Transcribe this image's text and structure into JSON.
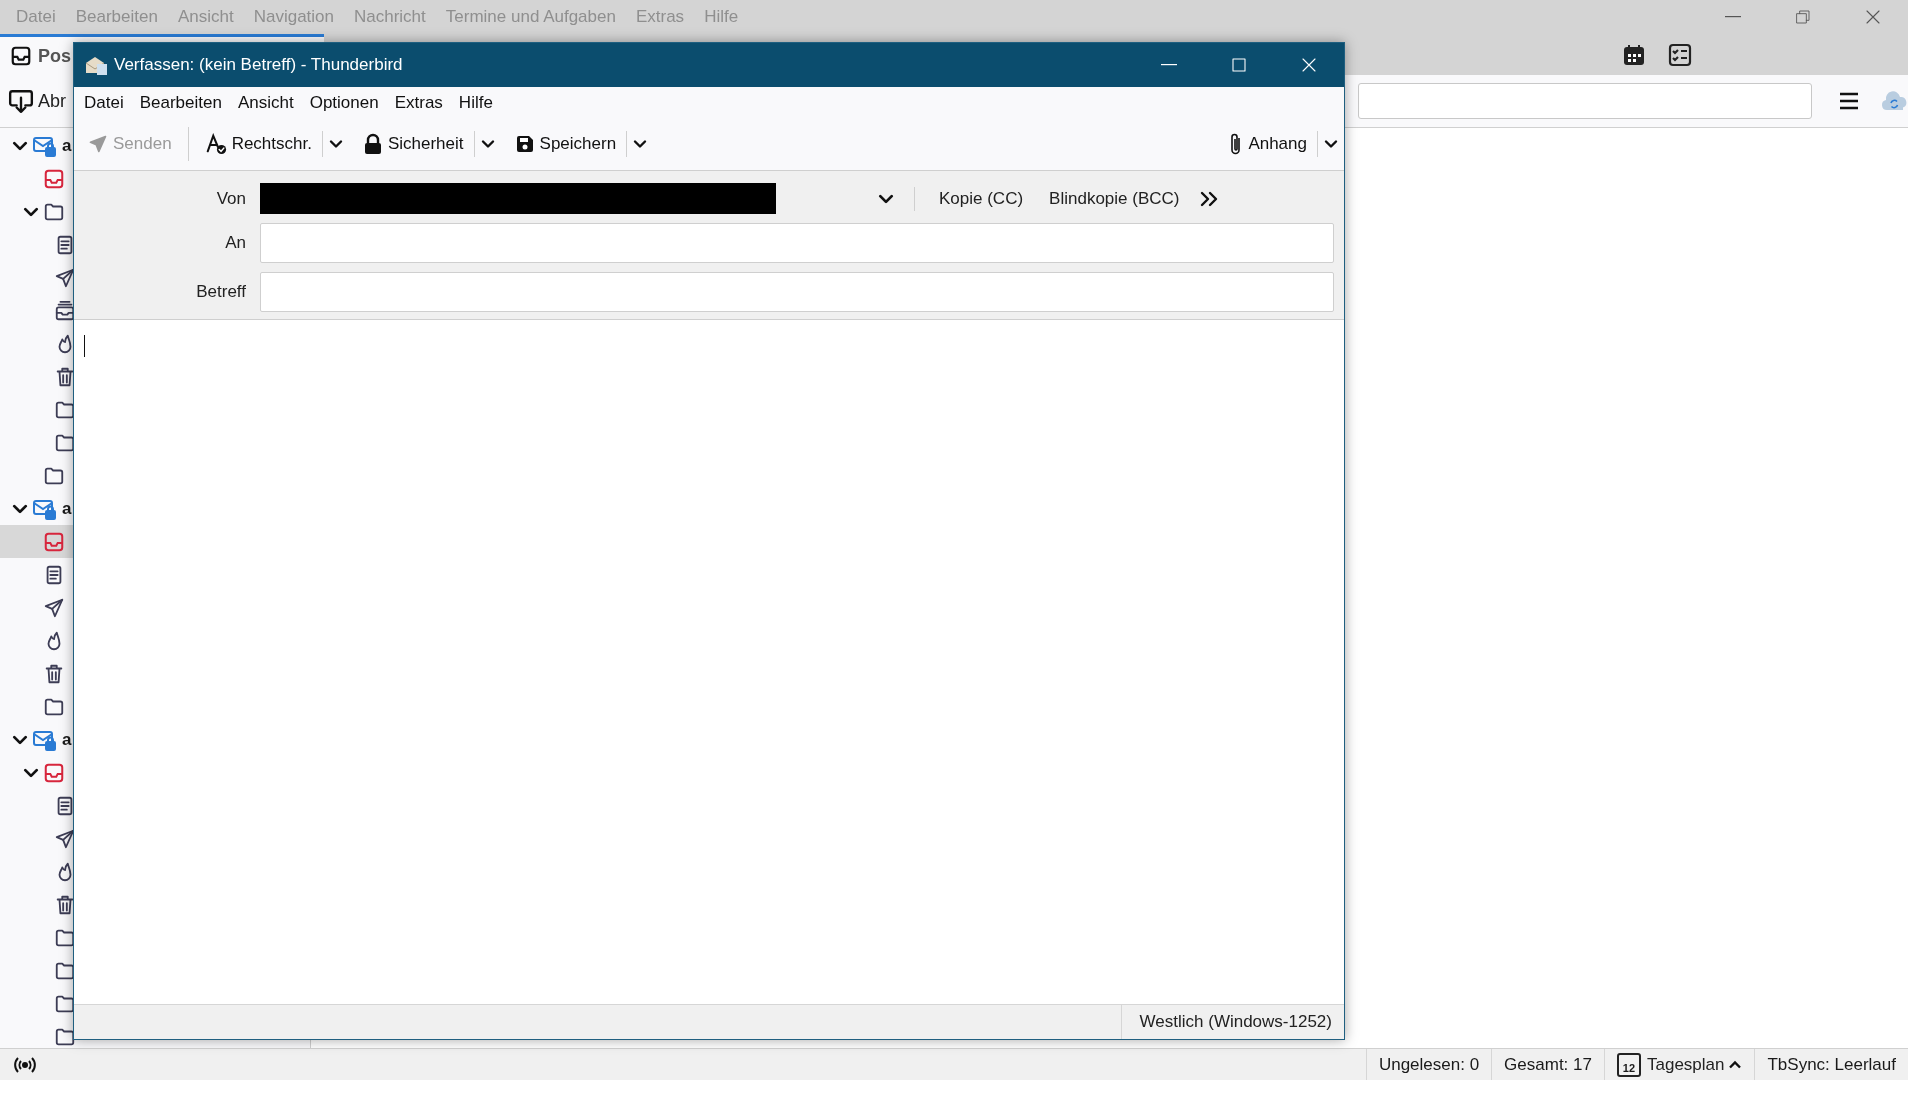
{
  "main_window": {
    "menu": [
      "Datei",
      "Bearbeiten",
      "Ansicht",
      "Navigation",
      "Nachricht",
      "Termine und Aufgaben",
      "Extras",
      "Hilfe"
    ],
    "tabs": [
      {
        "label": "Pos",
        "selected": true
      }
    ],
    "toolbar": {
      "get_messages": "Abr"
    },
    "folder_tree": [
      {
        "kind": "account",
        "label": "a",
        "expanded": true,
        "children": [
          {
            "kind": "inbox",
            "selected": false
          },
          {
            "kind": "folder",
            "selected": false,
            "expanded": true,
            "children": [
              {
                "kind": "drafts",
                "selected": false
              },
              {
                "kind": "sent",
                "selected": false
              },
              {
                "kind": "archive",
                "selected": false
              },
              {
                "kind": "junk",
                "selected": false
              },
              {
                "kind": "trash",
                "selected": false
              },
              {
                "kind": "folder",
                "selected": false
              },
              {
                "kind": "folder",
                "selected": false
              }
            ]
          },
          {
            "kind": "folder",
            "selected": false
          }
        ]
      },
      {
        "kind": "account",
        "label": "a",
        "expanded": true,
        "children": [
          {
            "kind": "inbox",
            "selected": true
          },
          {
            "kind": "drafts",
            "selected": false
          },
          {
            "kind": "sent",
            "selected": false
          },
          {
            "kind": "junk",
            "selected": false
          },
          {
            "kind": "trash",
            "selected": false
          },
          {
            "kind": "folder",
            "selected": false
          }
        ]
      },
      {
        "kind": "account",
        "label": "a",
        "expanded": true,
        "children": [
          {
            "kind": "inbox",
            "selected": false,
            "expanded": true,
            "children": [
              {
                "kind": "drafts",
                "selected": false
              },
              {
                "kind": "sent",
                "selected": false
              },
              {
                "kind": "junk",
                "selected": false
              },
              {
                "kind": "trash",
                "selected": false
              },
              {
                "kind": "folder",
                "selected": false
              },
              {
                "kind": "folder",
                "selected": false
              },
              {
                "kind": "folder",
                "selected": false
              },
              {
                "kind": "folder",
                "selected": false
              }
            ]
          }
        ]
      }
    ],
    "status_bar": {
      "unread": "Ungelesen: 0",
      "total": "Gesamt: 17",
      "calendar_day": "12",
      "today_pane": "Tagesplan",
      "sync": "TbSync: Leerlauf"
    }
  },
  "compose": {
    "title": "Verfassen: (kein Betreff) - Thunderbird",
    "menu": [
      "Datei",
      "Bearbeiten",
      "Ansicht",
      "Optionen",
      "Extras",
      "Hilfe"
    ],
    "toolbar": [
      {
        "kind": "send",
        "label": "Senden",
        "disabled": true,
        "dropdown": false
      },
      {
        "kind": "spelling",
        "label": "Rechtschr.",
        "disabled": false,
        "dropdown": true
      },
      {
        "kind": "security",
        "label": "Sicherheit",
        "disabled": false,
        "dropdown": true
      },
      {
        "kind": "save",
        "label": "Speichern",
        "disabled": false,
        "dropdown": true
      }
    ],
    "attach": {
      "label": "Anhang",
      "dropdown": true
    },
    "from": {
      "label": "Von"
    },
    "cc": "Kopie (CC)",
    "bcc": "Blindkopie (BCC)",
    "to": {
      "label": "An"
    },
    "subject": {
      "label": "Betreff"
    },
    "encoding": "Westlich (Windows-1252)"
  }
}
